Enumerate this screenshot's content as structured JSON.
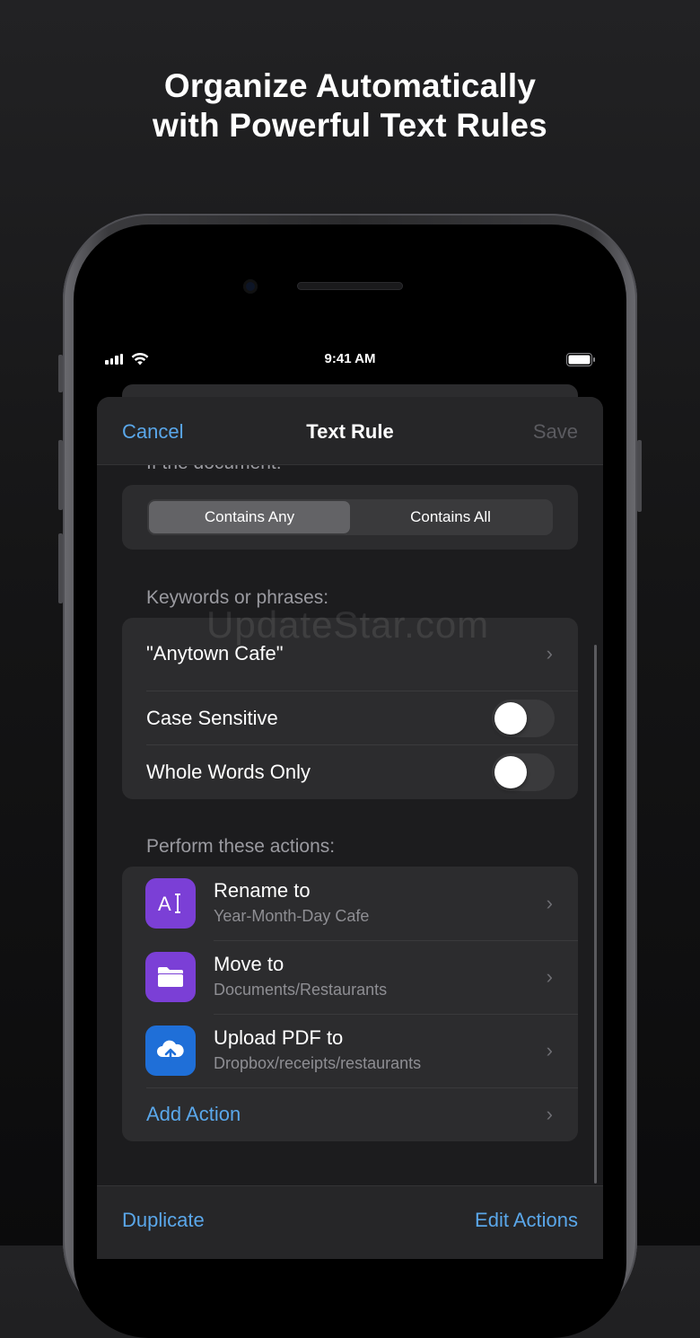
{
  "headline": {
    "line1": "Organize Automatically",
    "line2": "with Powerful Text Rules"
  },
  "status_bar": {
    "time": "9:41 AM"
  },
  "nav": {
    "cancel": "Cancel",
    "title": "Text Rule",
    "save": "Save"
  },
  "peek_label": "If the document:",
  "match_mode": {
    "options": [
      "Contains Any",
      "Contains All"
    ],
    "selected": "Contains Any"
  },
  "keywords_section": {
    "header": "Keywords or phrases:",
    "keyword": "\"Anytown Cafe\"",
    "case_sensitive": {
      "label": "Case Sensitive",
      "on": false
    },
    "whole_words": {
      "label": "Whole Words Only",
      "on": false
    }
  },
  "actions_section": {
    "header": "Perform these actions:",
    "items": [
      {
        "title": "Rename to",
        "subtitle": "Year-Month-Day Cafe",
        "icon": "rename-text-cursor-icon",
        "color": "#7b3fd6"
      },
      {
        "title": "Move to",
        "subtitle": "Documents/Restaurants",
        "icon": "folder-icon",
        "color": "#7b3fd6"
      },
      {
        "title": "Upload PDF to",
        "subtitle": "Dropbox/receipts/restaurants",
        "icon": "cloud-upload-icon",
        "color": "#1f6fd8"
      }
    ],
    "add_action": "Add Action"
  },
  "toolbar": {
    "duplicate": "Duplicate",
    "edit_actions": "Edit Actions"
  },
  "watermark": "UpdateStar.com",
  "colors": {
    "accent": "#5aa7ea",
    "background": "#1c1c1e",
    "card": "#2c2c2e"
  }
}
